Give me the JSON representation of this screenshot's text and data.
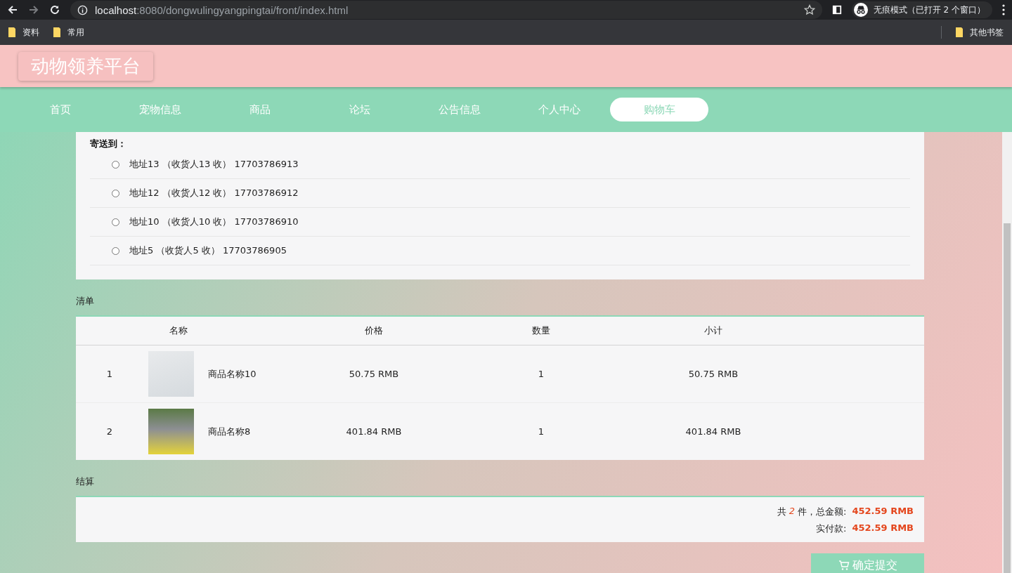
{
  "browser": {
    "url_host": "localhost",
    "url_rest": ":8080/dongwulingyangpingtai/front/index.html",
    "profile_label": "无痕模式（已打开 2 个窗口）",
    "bookmarks": [
      "资料",
      "常用"
    ],
    "other_bookmarks": "其他书签"
  },
  "site_title": "动物领养平台",
  "nav": [
    {
      "label": "首页",
      "selected": false
    },
    {
      "label": "宠物信息",
      "selected": false
    },
    {
      "label": "商品",
      "selected": false
    },
    {
      "label": "论坛",
      "selected": false
    },
    {
      "label": "公告信息",
      "selected": false
    },
    {
      "label": "个人中心",
      "selected": false
    },
    {
      "label": "购物车",
      "selected": true
    }
  ],
  "address": {
    "label": "寄送到：",
    "options": [
      {
        "text": "地址13 （收货人13 收） 17703786913",
        "selected": false
      },
      {
        "text": "地址12 （收货人12 收） 17703786912",
        "selected": false
      },
      {
        "text": "地址10 （收货人10 收） 17703786910",
        "selected": false
      },
      {
        "text": "地址5 （收货人5 收） 17703786905",
        "selected": false
      }
    ]
  },
  "cart": {
    "title": "清单",
    "columns": [
      "名称",
      "价格",
      "数量",
      "小计"
    ],
    "rows": [
      {
        "index": "1",
        "name": "商品名称10",
        "price": "50.75 RMB",
        "quantity": "1",
        "subtotal": "50.75 RMB"
      },
      {
        "index": "2",
        "name": "商品名称8",
        "price": "401.84 RMB",
        "quantity": "1",
        "subtotal": "401.84 RMB"
      }
    ]
  },
  "checkout": {
    "title": "结算",
    "count_prefix": "共",
    "count": "2",
    "count_suffix": "件，总金额:",
    "total": "452.59 RMB",
    "paid_label": "实付款:",
    "paid": "452.59 RMB"
  },
  "submit_button": "确定提交"
}
